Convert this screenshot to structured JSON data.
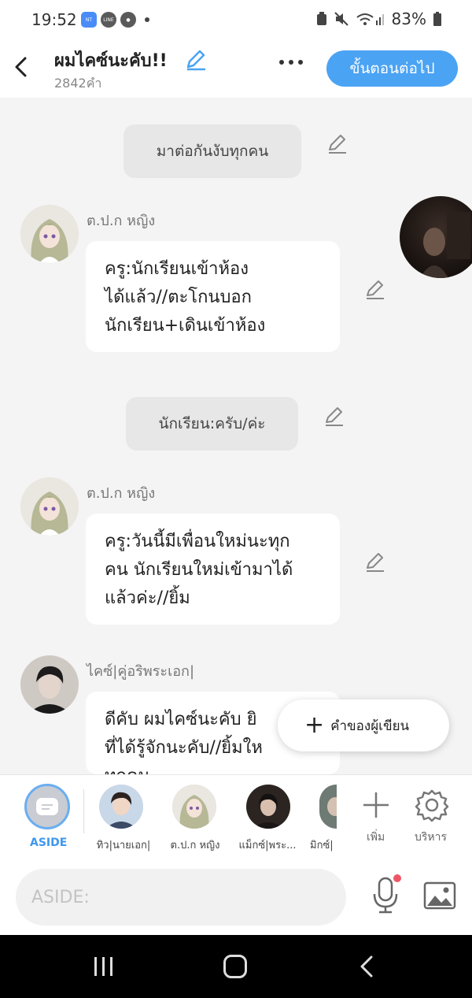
{
  "status": {
    "time": "19:52",
    "battery": "83%"
  },
  "header": {
    "title": "ผมไคซ์นะคับ!!",
    "word_count": "2842คำ",
    "next_button": "ขั้นตอนต่อไป"
  },
  "messages": [
    {
      "type": "narration",
      "text": "มาต่อกันงับทุกคน"
    },
    {
      "type": "character",
      "speaker": "ต.ป.ก หญิง",
      "text": "ครู:นักเรียนเข้าห้อง\nได้แล้ว//ตะโกนบอก\nนักเรียน+เดินเข้าห้อง"
    },
    {
      "type": "narration",
      "text": "นักเรียน:ครับ/ค่ะ"
    },
    {
      "type": "character",
      "speaker": "ต.ป.ก หญิง",
      "text": "ครู:วันนี้มีเพื่อนใหม่นะทุก\nคน นักเรียนใหม่เข้ามาได้\nแล้วค่ะ//ยิ้ม"
    },
    {
      "type": "character",
      "speaker": "ไคซ์|คู่อริพระเอก|",
      "text": "ดีคับ ผมไคซ์นะคับ ยิ\nที่ได้รู้จักนะคับ//ยิ้มให\nทุกคน"
    }
  ],
  "writer_button": "คำของผู้เขียน",
  "character_bar": {
    "aside_label": "ASIDE",
    "characters": [
      {
        "name": "ทิว|นายเอก|"
      },
      {
        "name": "ต.ป.ก หญิง"
      },
      {
        "name": "แม็กซ์|พระ..."
      },
      {
        "name": "มิกซ์|"
      }
    ],
    "add_label": "เพิ่ม",
    "manage_label": "บริหาร"
  },
  "input": {
    "placeholder": "ASIDE:"
  },
  "colors": {
    "accent": "#4ba3f3",
    "bubble": "#ffffff",
    "narration": "#e7e7e7",
    "background": "#f4f4f4"
  }
}
